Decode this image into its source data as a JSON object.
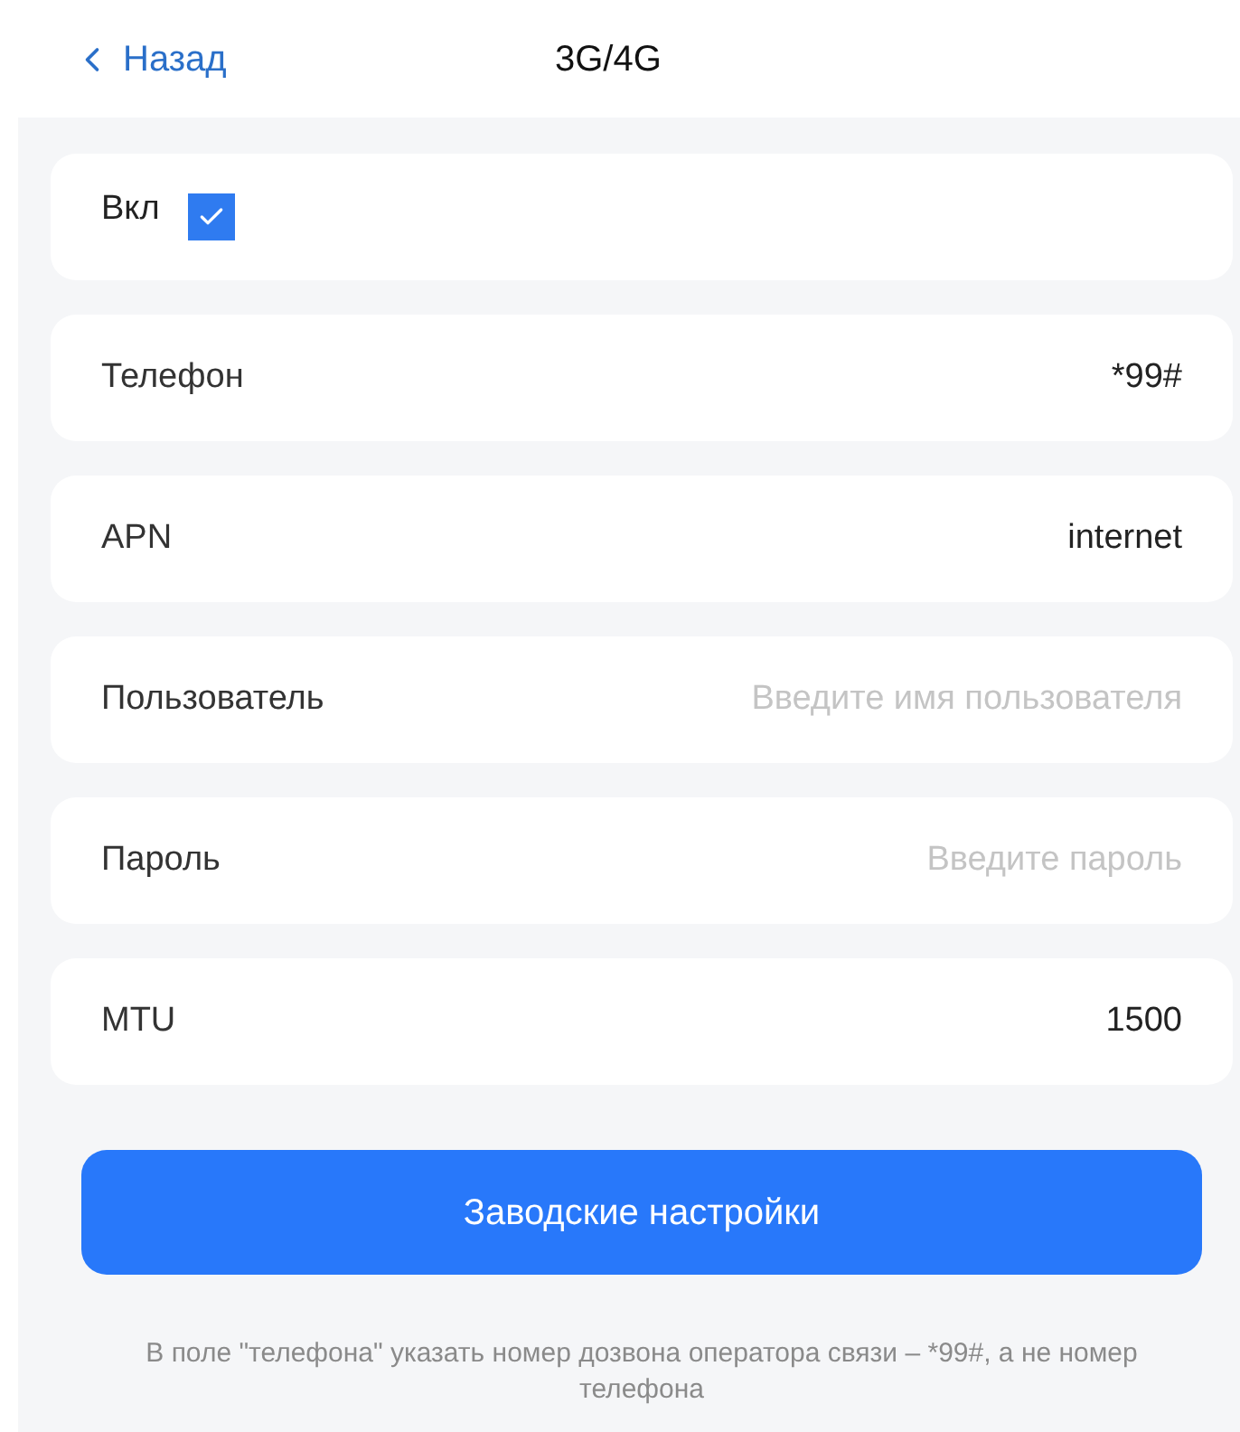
{
  "header": {
    "back": "Назад",
    "title": "3G/4G"
  },
  "rows": [
    {
      "kind": "checkbox",
      "label": "Вкл",
      "checked": true
    },
    {
      "kind": "field",
      "label": "Телефон",
      "value": "*99#"
    },
    {
      "kind": "field",
      "label": "APN",
      "value": "internet"
    },
    {
      "kind": "field",
      "label": "Пользователь",
      "placeholder": "Введите имя пользователя"
    },
    {
      "kind": "field",
      "label": "Пароль",
      "placeholder": "Введите пароль"
    },
    {
      "kind": "field",
      "label": "MTU",
      "value": "1500"
    }
  ],
  "button": "Заводские настройки",
  "note": "В поле \"телефона\" указать номер дозвона оператора связи – *99#, а не номер телефона"
}
